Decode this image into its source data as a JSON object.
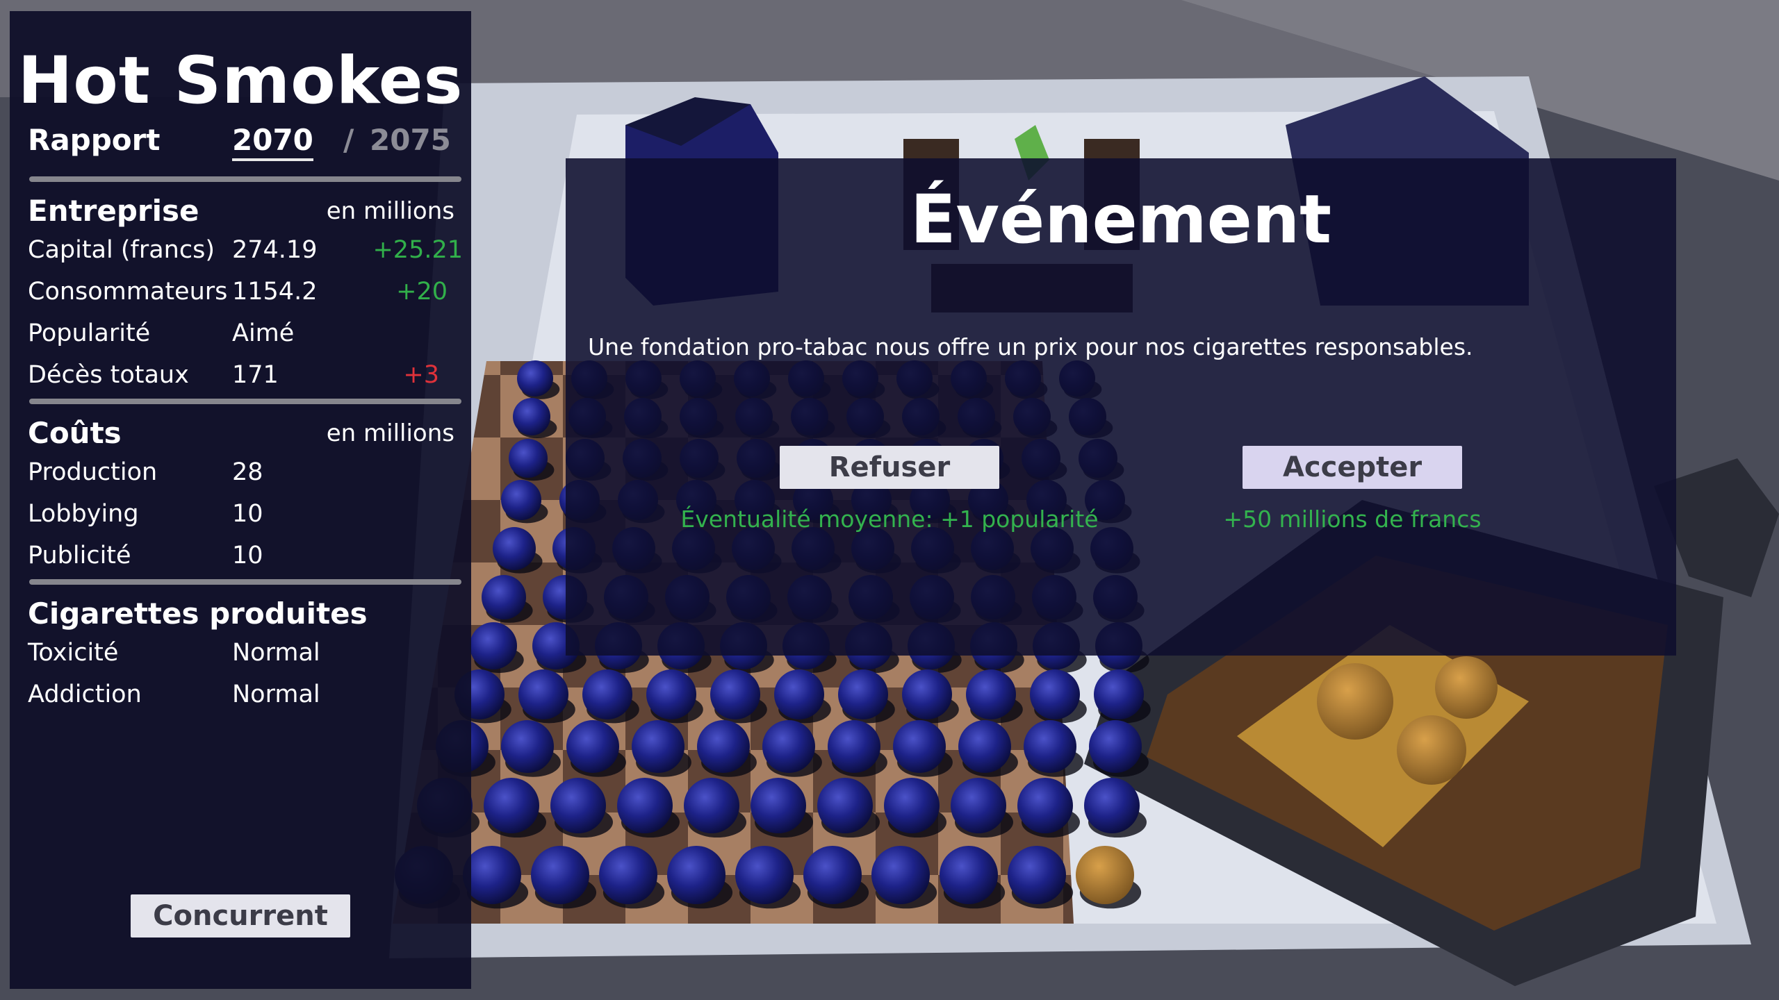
{
  "report": {
    "title": "Hot Smokes",
    "rapport_label": "Rapport",
    "year_current": "2070",
    "year_separator": "/",
    "year_max": "2075",
    "entreprise": {
      "heading": "Entreprise",
      "unit": "en millions",
      "rows": [
        {
          "label": "Capital (francs)",
          "value": "274.19",
          "delta": "+25.21"
        },
        {
          "label": "Consommateurs",
          "value": "1154.2",
          "delta": "+20"
        },
        {
          "label": "Popularité",
          "value": "Aimé",
          "delta": ""
        },
        {
          "label": "Décès totaux",
          "value": "171",
          "delta": "+3"
        }
      ]
    },
    "couts": {
      "heading": "Coûts",
      "unit": "en millions",
      "rows": [
        {
          "label": "Production",
          "value": "28"
        },
        {
          "label": "Lobbying",
          "value": "10"
        },
        {
          "label": "Publicité",
          "value": "10"
        }
      ]
    },
    "cigarettes": {
      "heading": "Cigarettes produites",
      "rows": [
        {
          "label": "Toxicité",
          "value": "Normal"
        },
        {
          "label": "Addiction",
          "value": "Normal"
        }
      ]
    },
    "concurrent_button": "Concurrent"
  },
  "event": {
    "title": "Événement",
    "description": "Une fondation pro-tabac nous offre un prix pour nos cigarettes responsables.",
    "refuse_button": "Refuser",
    "refuse_effect": "Éventualité moyenne: +1 popularité",
    "accept_button": "Accepter",
    "accept_effect": "+50 millions de francs"
  },
  "colors": {
    "panel_bg": "#0e0e28",
    "positive": "#31b04a",
    "negative": "#e0323a",
    "effect_green": "#33b34e",
    "button_bg": "#e4e4ec",
    "accept_button_bg": "#d9d4ef"
  }
}
